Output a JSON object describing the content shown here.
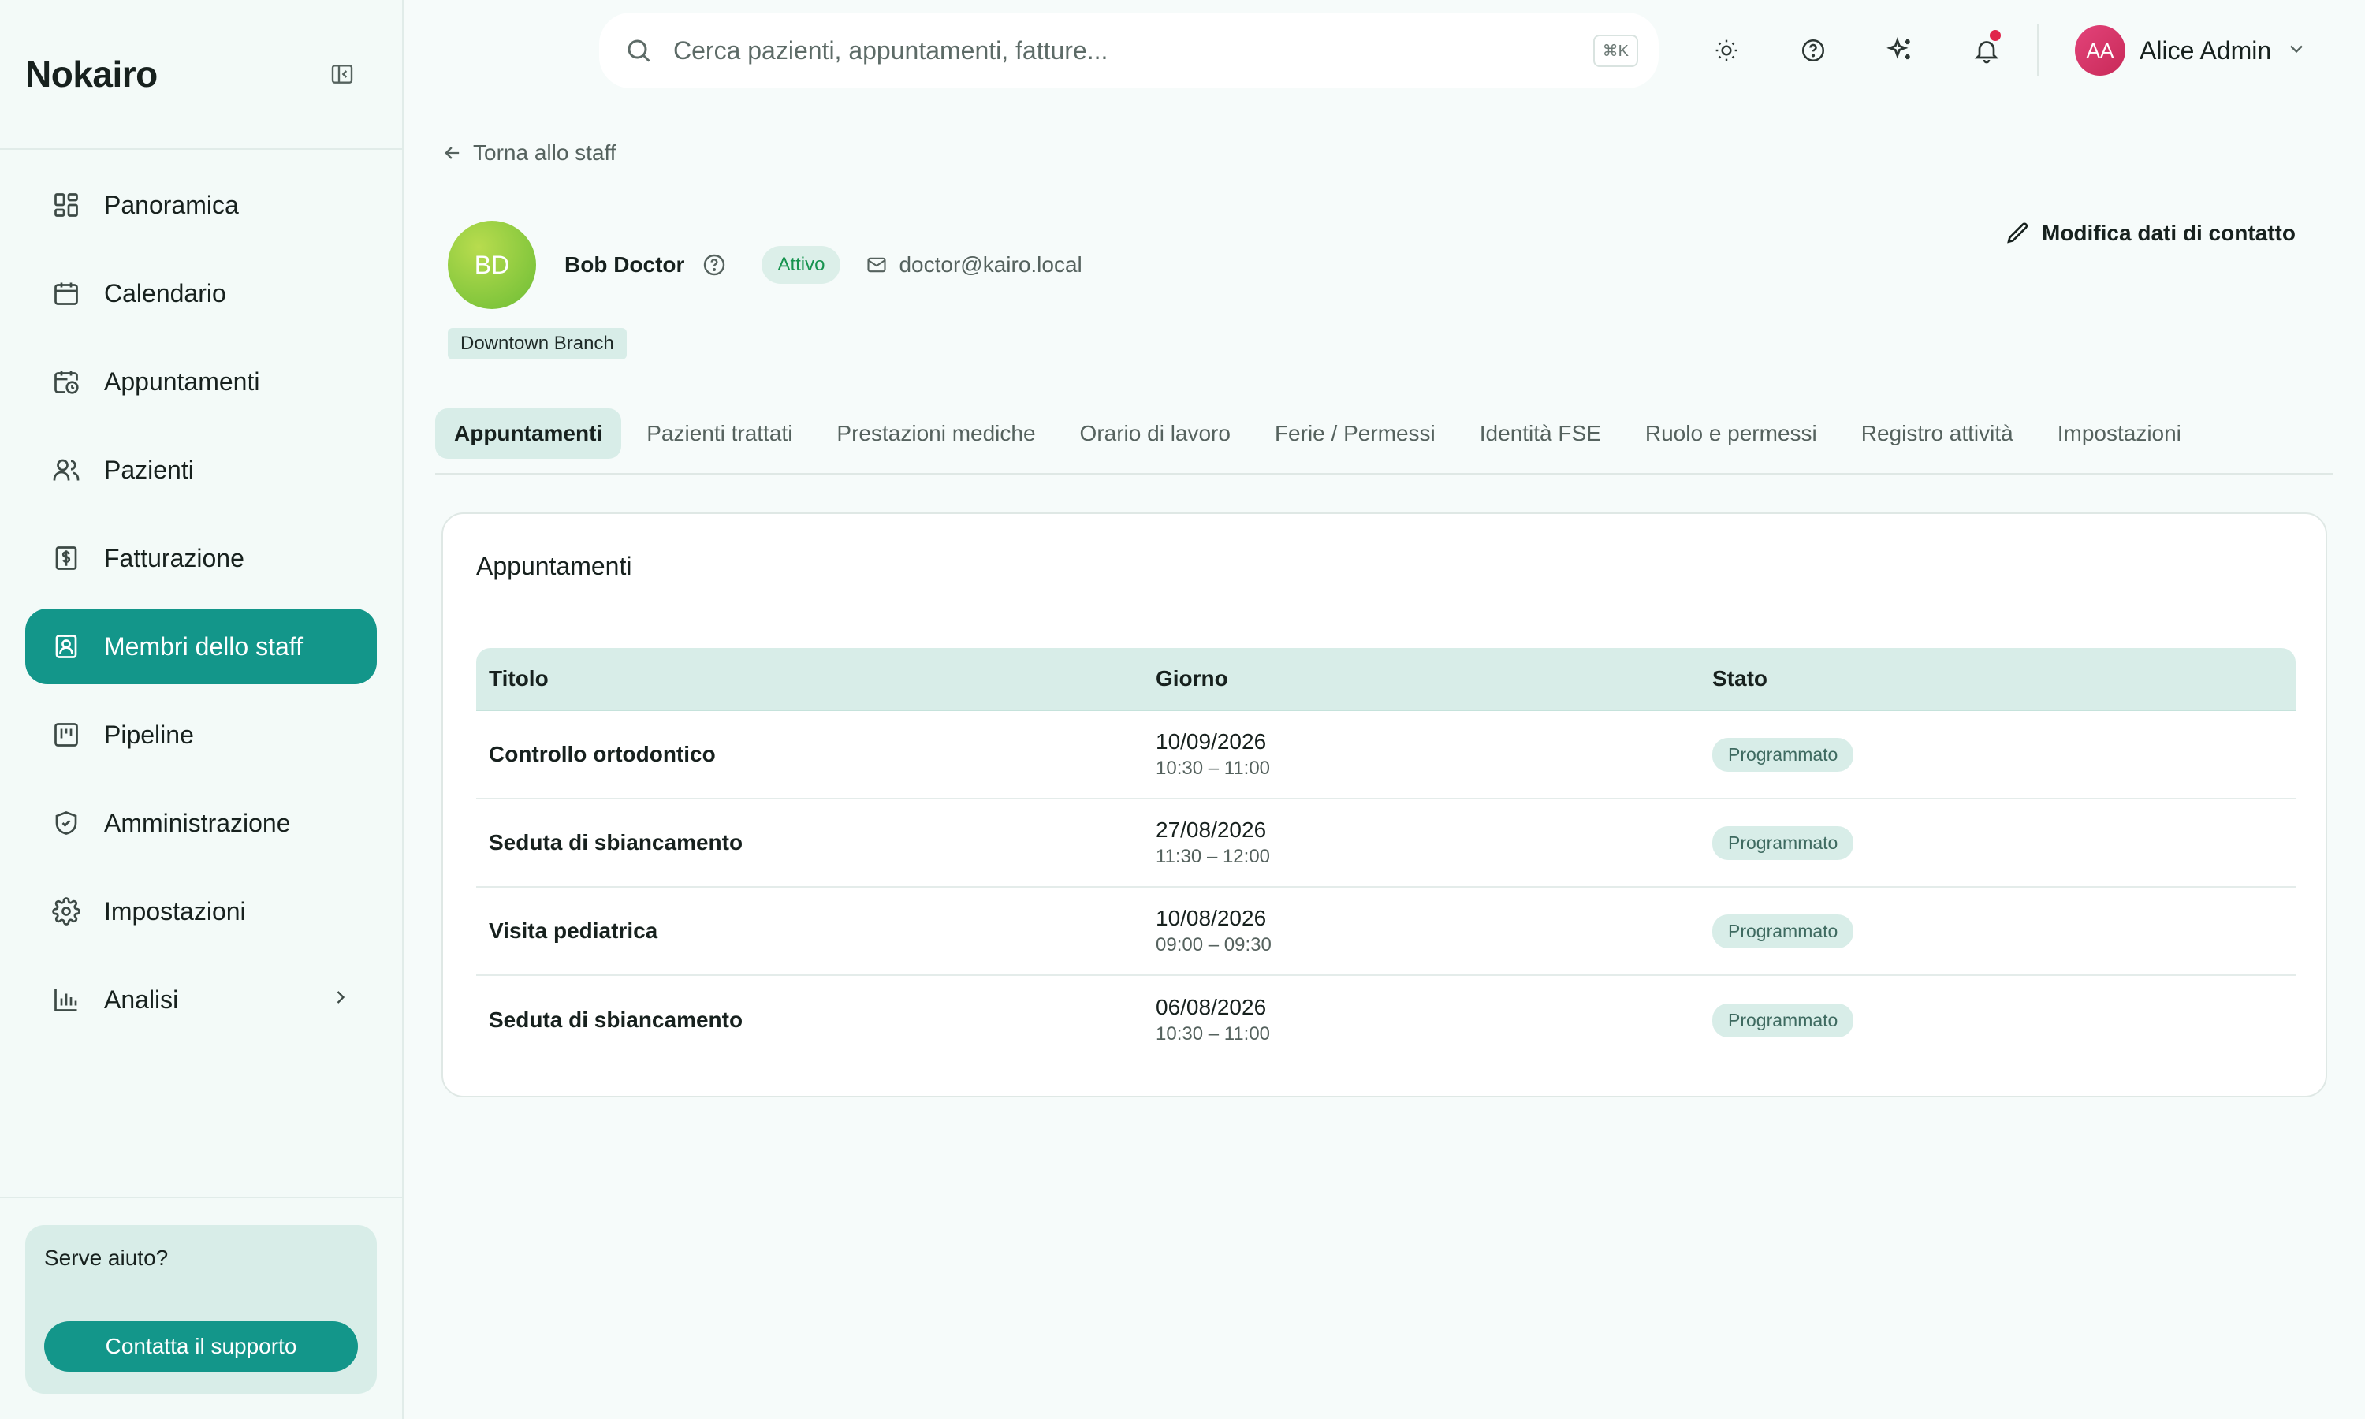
{
  "sidebar": {
    "brand": "Nokairo",
    "items": [
      {
        "label": "Panoramica",
        "icon": "dashboard-icon"
      },
      {
        "label": "Calendario",
        "icon": "calendar-icon"
      },
      {
        "label": "Appuntamenti",
        "icon": "calendar-clock-icon"
      },
      {
        "label": "Pazienti",
        "icon": "users-icon"
      },
      {
        "label": "Fatturazione",
        "icon": "invoice-icon"
      },
      {
        "label": "Membri dello staff",
        "icon": "id-badge-icon"
      },
      {
        "label": "Pipeline",
        "icon": "kanban-icon"
      },
      {
        "label": "Amministrazione",
        "icon": "shield-icon"
      },
      {
        "label": "Impostazioni",
        "icon": "gear-icon"
      },
      {
        "label": "Analisi",
        "icon": "bar-chart-icon"
      }
    ],
    "help": {
      "title": "Serve aiuto?",
      "button": "Contatta il supporto"
    }
  },
  "topbar": {
    "search_placeholder": "Cerca pazienti, appuntamenti, fatture...",
    "shortcut": "⌘K",
    "user": {
      "initials": "AA",
      "name": "Alice Admin"
    }
  },
  "colors": {
    "accent": "#13968a",
    "accent_light": "#d8ede8",
    "notification": "#e0244a"
  },
  "profile": {
    "back_label": "Torna allo staff",
    "initials": "BD",
    "name": "Bob Doctor",
    "status": "Attivo",
    "email": "doctor@kairo.local",
    "branch": "Downtown Branch",
    "edit_label": "Modifica dati di contatto"
  },
  "tabs": [
    {
      "label": "Appuntamenti"
    },
    {
      "label": "Pazienti trattati"
    },
    {
      "label": "Prestazioni mediche"
    },
    {
      "label": "Orario di lavoro"
    },
    {
      "label": "Ferie / Permessi"
    },
    {
      "label": "Identità FSE"
    },
    {
      "label": "Ruolo e permessi"
    },
    {
      "label": "Registro attività"
    },
    {
      "label": "Impostazioni"
    }
  ],
  "appointments": {
    "title": "Appuntamenti",
    "columns": [
      "Titolo",
      "Giorno",
      "Stato"
    ],
    "rows": [
      {
        "title": "Controllo ortodontico",
        "date": "10/09/2026",
        "time": "10:30 – 11:00",
        "status": "Programmato"
      },
      {
        "title": "Seduta di sbiancamento",
        "date": "27/08/2026",
        "time": "11:30 – 12:00",
        "status": "Programmato"
      },
      {
        "title": "Visita pediatrica",
        "date": "10/08/2026",
        "time": "09:00 – 09:30",
        "status": "Programmato"
      },
      {
        "title": "Seduta di sbiancamento",
        "date": "06/08/2026",
        "time": "10:30 – 11:00",
        "status": "Programmato"
      }
    ]
  }
}
